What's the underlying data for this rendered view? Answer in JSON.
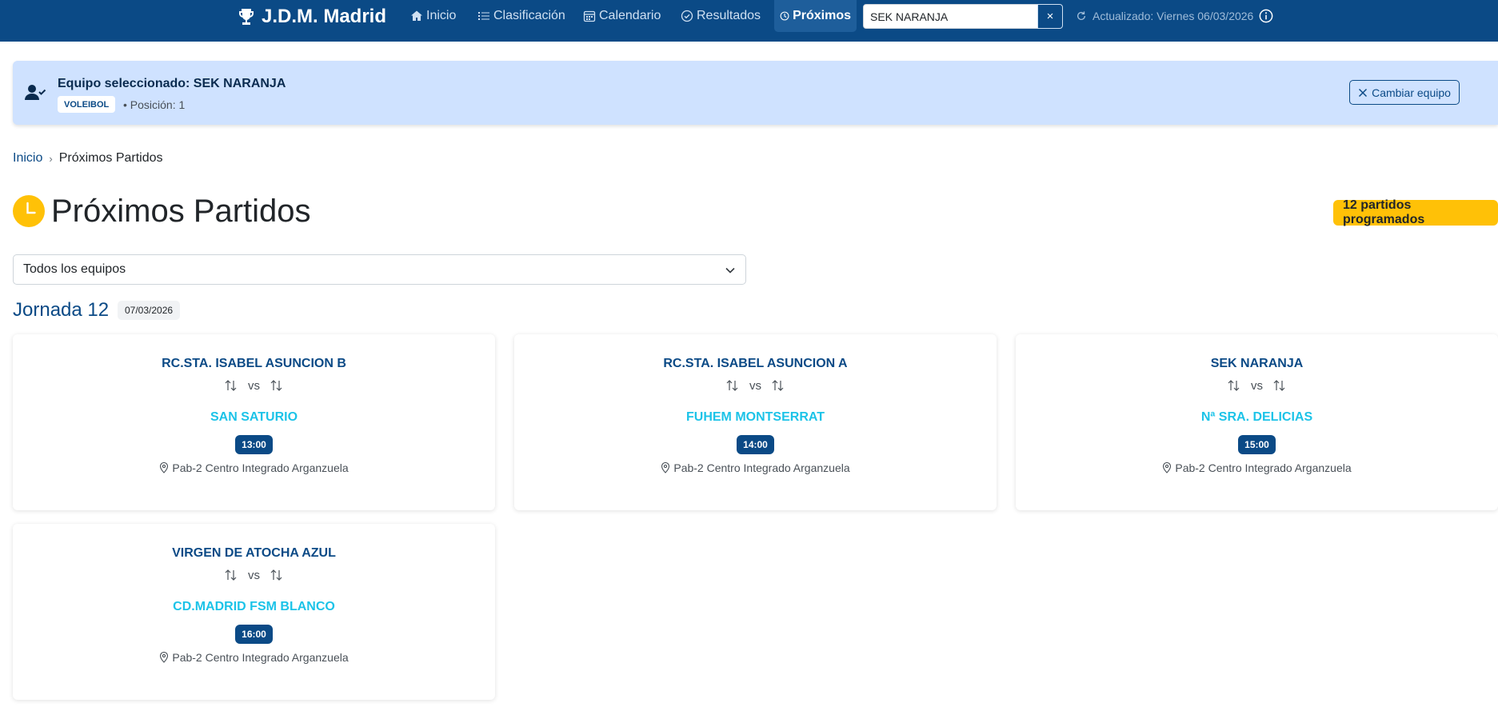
{
  "navbar": {
    "brand": "J.D.M. Madrid",
    "items": [
      {
        "label": "Inicio",
        "icon": "house-icon"
      },
      {
        "label": "Clasificación",
        "icon": "list-icon"
      },
      {
        "label": "Calendario",
        "icon": "calendar-icon"
      },
      {
        "label": "Resultados",
        "icon": "check-circle-icon"
      },
      {
        "label": "Próximos",
        "icon": "clock-icon",
        "active": true
      }
    ],
    "team_input_value": "SEK NARANJA",
    "clear_label": "×",
    "updated_text": "Actualizado: Viernes 06/03/2026"
  },
  "selected_team": {
    "title": "Equipo seleccionado: SEK NARANJA",
    "sport": "VOLEIBOL",
    "position": "• Posición: 1",
    "change_button": "Cambiar equipo"
  },
  "breadcrumb": {
    "home": "Inicio",
    "separator": "›",
    "current": "Próximos Partidos"
  },
  "page": {
    "title": "Próximos Partidos",
    "count_badge": "12 partidos programados"
  },
  "filter": {
    "selected": "Todos los equipos"
  },
  "round": {
    "title": "Jornada 12",
    "date": "07/03/2026",
    "matches": [
      {
        "home": "RC.STA. ISABEL ASUNCION B",
        "away": "SAN SATURIO",
        "vs": "vs",
        "time": "13:00",
        "venue": "Pab-2 Centro Integrado Arganzuela"
      },
      {
        "home": "RC.STA. ISABEL ASUNCION A",
        "away": "FUHEM MONTSERRAT",
        "vs": "vs",
        "time": "14:00",
        "venue": "Pab-2 Centro Integrado Arganzuela"
      },
      {
        "home": "SEK NARANJA",
        "away": "Nª SRA. DELICIAS",
        "vs": "vs",
        "time": "15:00",
        "venue": "Pab-2 Centro Integrado Arganzuela"
      },
      {
        "home": "VIRGEN DE ATOCHA AZUL",
        "away": "CD.MADRID FSM BLANCO",
        "vs": "vs",
        "time": "16:00",
        "venue": "Pab-2 Centro Integrado Arganzuela"
      }
    ]
  },
  "colors": {
    "navbar": "#0b4a86",
    "accent": "#1cc3e8",
    "warning": "#ffc107",
    "banner": "#cfe2ff"
  }
}
